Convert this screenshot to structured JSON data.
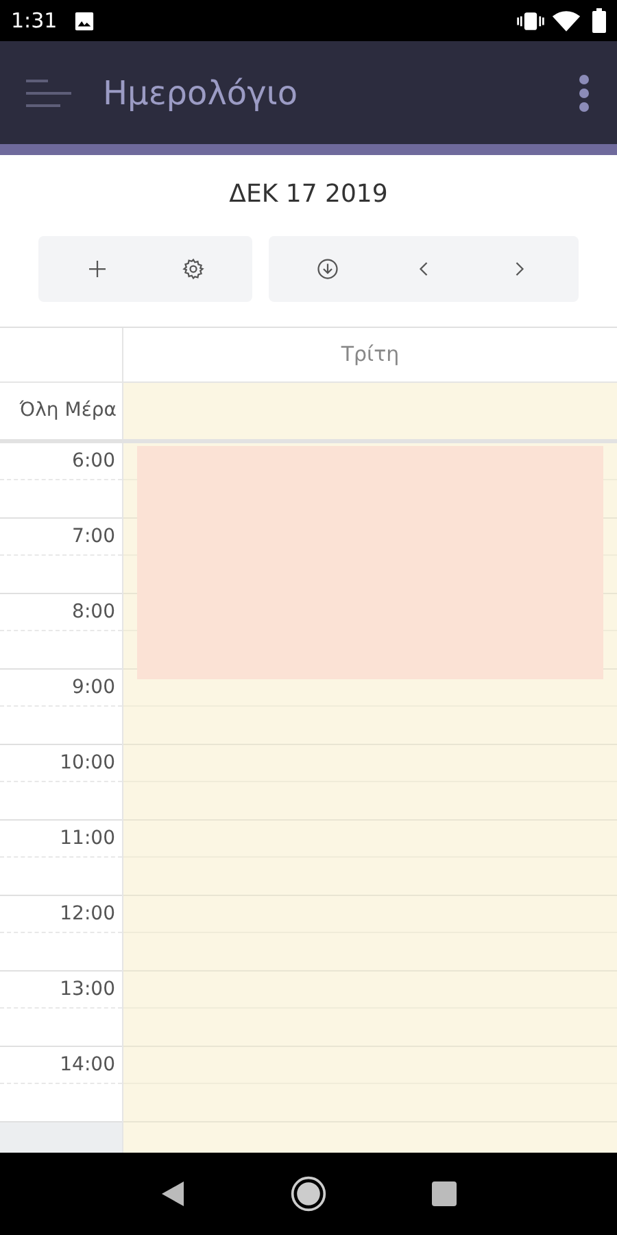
{
  "status_bar": {
    "time": "1:31"
  },
  "app_bar": {
    "title": "Ημερολόγιο"
  },
  "date_title": "ΔΕΚ 17 2019",
  "toolbar": {
    "groups": [
      {
        "buttons": [
          {
            "kind": "add"
          },
          {
            "kind": "settings"
          }
        ]
      },
      {
        "buttons": [
          {
            "kind": "download"
          },
          {
            "kind": "previous"
          },
          {
            "kind": "next"
          }
        ]
      }
    ]
  },
  "calendar": {
    "day_header": "Τρίτη",
    "all_day_label": "Όλη Μέρα",
    "hours": [
      "6:00",
      "7:00",
      "8:00",
      "9:00",
      "10:00",
      "11:00",
      "12:00",
      "13:00",
      "14:00"
    ],
    "events": [
      {
        "color": "#fbe2d5"
      }
    ]
  }
}
